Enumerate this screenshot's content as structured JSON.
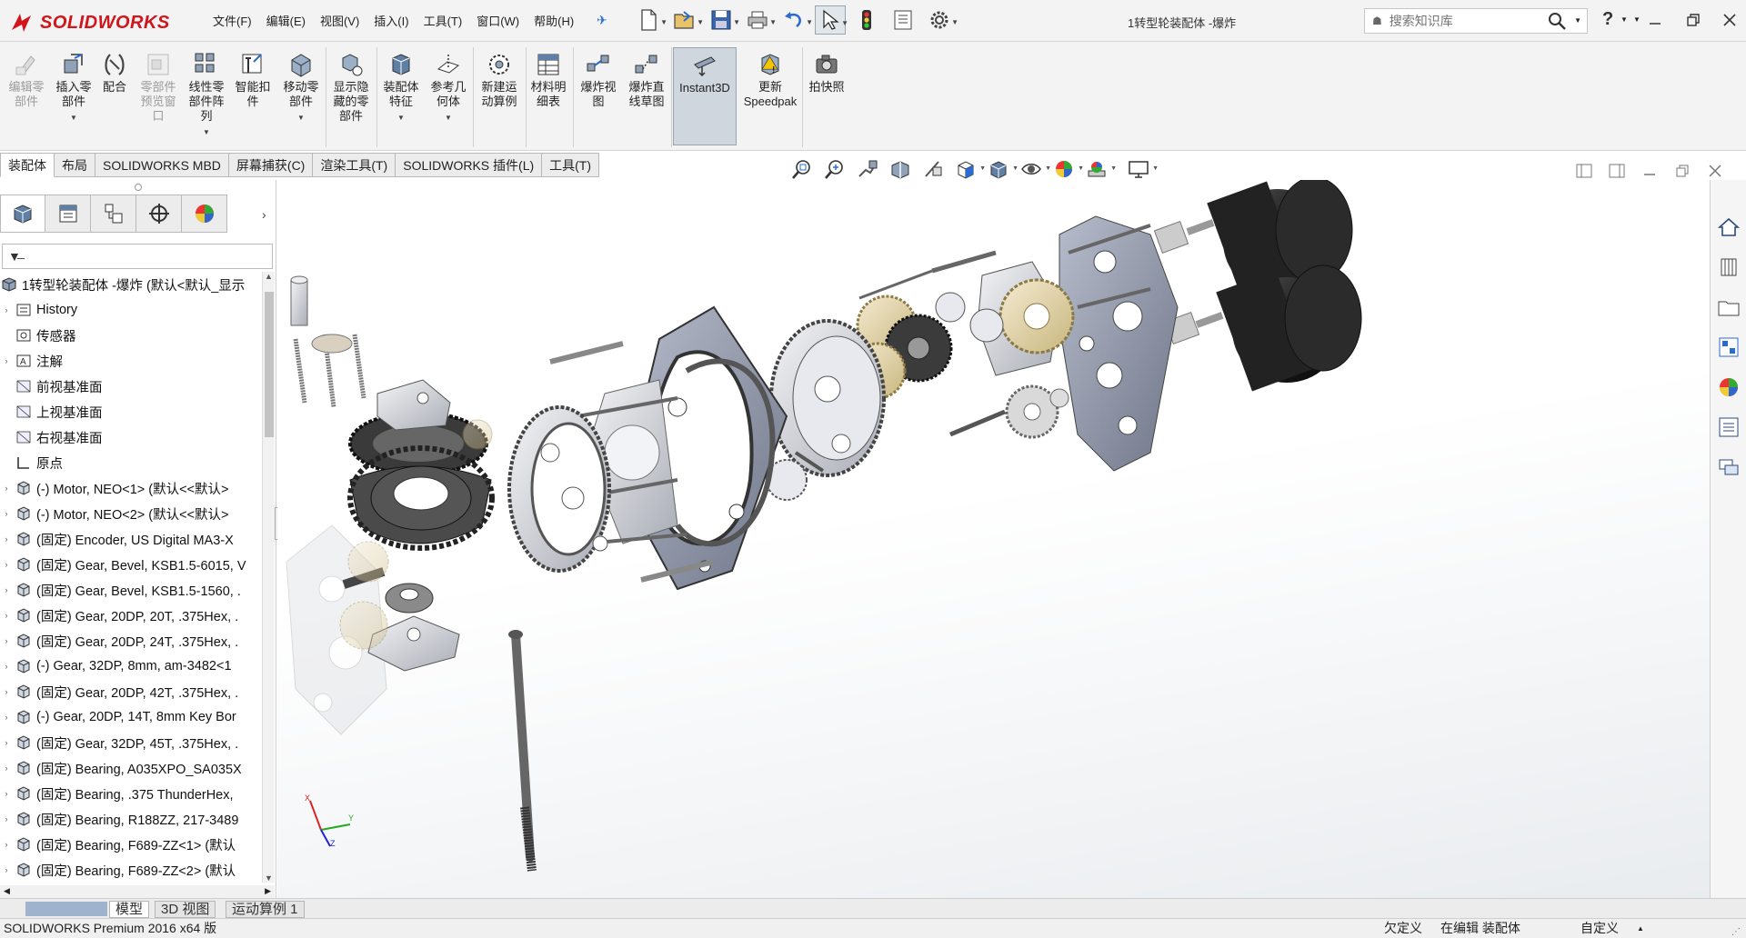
{
  "app": {
    "brand": "SOLIDWORKS",
    "document_title": "1转型轮装配体 -爆炸"
  },
  "menus": [
    "文件(F)",
    "编辑(E)",
    "视图(V)",
    "插入(I)",
    "工具(T)",
    "窗口(W)",
    "帮助(H)"
  ],
  "quick_access": [
    "new-icon",
    "open-icon",
    "save-icon",
    "print-icon",
    "undo-icon",
    "select-icon",
    "rebuild-icon",
    "file-properties-icon",
    "options-icon"
  ],
  "search": {
    "placeholder": "搜索知识库"
  },
  "help_label": "?",
  "commands": [
    {
      "label": "编辑零\n部件",
      "icon": "edit-component-icon",
      "disabled": true
    },
    {
      "label": "插入零\n部件",
      "icon": "insert-component-icon",
      "dropdown": true
    },
    {
      "label": "配合",
      "icon": "mate-icon"
    },
    {
      "label": "零部件\n预览窗\n口",
      "icon": "component-preview-icon",
      "disabled": true
    },
    {
      "label": "线性零\n部件阵\n列",
      "icon": "linear-pattern-icon",
      "dropdown": true
    },
    {
      "label": "智能扣\n件",
      "icon": "smart-fasteners-icon"
    },
    {
      "label": "移动零\n部件",
      "icon": "move-component-icon",
      "dropdown": true
    },
    {
      "label": "显示隐\n藏的零\n部件",
      "icon": "show-hidden-icon"
    },
    {
      "label": "装配体\n特征",
      "icon": "assembly-features-icon",
      "dropdown": true
    },
    {
      "label": "参考几\n何体",
      "icon": "reference-geometry-icon",
      "dropdown": true
    },
    {
      "label": "新建运\n动算例",
      "icon": "new-motion-study-icon"
    },
    {
      "label": "材料明\n细表",
      "icon": "bom-icon"
    },
    {
      "label": "爆炸视\n图",
      "icon": "exploded-view-icon"
    },
    {
      "label": "爆炸直\n线草图",
      "icon": "explode-line-sketch-icon"
    },
    {
      "label": "Instant3D",
      "icon": "instant3d-icon",
      "active": true
    },
    {
      "label": "更新\nSpeedpak",
      "icon": "speedpak-icon"
    },
    {
      "label": "拍快照",
      "icon": "snapshot-icon"
    }
  ],
  "command_tabs": [
    "装配体",
    "布局",
    "SOLIDWORKS MBD",
    "屏幕捕获(C)",
    "渲染工具(T)",
    "SOLIDWORKS 插件(L)",
    "工具(T)"
  ],
  "heads_up": [
    "zoom-to-fit-icon",
    "zoom-to-area-icon",
    "previous-view-icon",
    "section-view-icon",
    "dynamic-annotation-icon",
    "view-orientation-icon",
    "display-style-icon",
    "hide-show-icon",
    "edit-appearance-icon",
    "apply-scene-icon",
    "view-settings-icon"
  ],
  "panel_tabs": [
    "featuremanager-icon",
    "propertymanager-icon",
    "configurationmanager-icon",
    "dimxpert-icon",
    "display-manager-icon"
  ],
  "tree": {
    "root": "1转型轮装配体 -爆炸 (默认<默认_显示",
    "items": [
      {
        "label": "History",
        "icon": "history-icon",
        "expandable": true
      },
      {
        "label": "传感器",
        "icon": "sensor-icon",
        "expandable": false
      },
      {
        "label": "注解",
        "icon": "annotation-icon",
        "expandable": true
      },
      {
        "label": "前视基准面",
        "icon": "plane-icon",
        "expandable": false
      },
      {
        "label": "上视基准面",
        "icon": "plane-icon",
        "expandable": false
      },
      {
        "label": "右视基准面",
        "icon": "plane-icon",
        "expandable": false
      },
      {
        "label": "原点",
        "icon": "origin-icon",
        "expandable": false
      },
      {
        "label": "(-) Motor, NEO<1> (默认<<默认>",
        "icon": "part-icon",
        "expandable": true
      },
      {
        "label": "(-) Motor, NEO<2> (默认<<默认>",
        "icon": "part-icon",
        "expandable": true
      },
      {
        "label": "(固定) Encoder, US Digital MA3-X",
        "icon": "part-icon",
        "expandable": true
      },
      {
        "label": "(固定) Gear, Bevel, KSB1.5-6015, V",
        "icon": "part-icon",
        "expandable": true
      },
      {
        "label": "(固定) Gear, Bevel, KSB1.5-1560, .",
        "icon": "part-icon",
        "expandable": true
      },
      {
        "label": "(固定) Gear, 20DP, 20T, .375Hex, .",
        "icon": "part-icon",
        "expandable": true
      },
      {
        "label": "(固定) Gear, 20DP, 24T, .375Hex, .",
        "icon": "part-icon",
        "expandable": true
      },
      {
        "label": "(-) Gear, 32DP, 8mm, am-3482<1",
        "icon": "part-icon",
        "expandable": true
      },
      {
        "label": "(固定) Gear, 20DP, 42T, .375Hex, .",
        "icon": "part-icon",
        "expandable": true
      },
      {
        "label": "(-) Gear, 20DP, 14T, 8mm Key Bor",
        "icon": "part-icon",
        "expandable": true
      },
      {
        "label": "(固定) Gear, 32DP, 45T, .375Hex, .",
        "icon": "part-icon",
        "expandable": true
      },
      {
        "label": "(固定) Bearing, A035XPO_SA035X",
        "icon": "part-icon",
        "expandable": true
      },
      {
        "label": "(固定) Bearing, .375 ThunderHex,",
        "icon": "part-icon",
        "expandable": true
      },
      {
        "label": "(固定) Bearing, R188ZZ, 217-3489",
        "icon": "part-icon",
        "expandable": true
      },
      {
        "label": "(固定) Bearing, F689-ZZ<1> (默认",
        "icon": "part-icon",
        "expandable": true
      },
      {
        "label": "(固定) Bearing, F689-ZZ<2> (默认",
        "icon": "part-icon",
        "expandable": true
      }
    ]
  },
  "task_pane": [
    "solidworks-resources-icon",
    "design-library-icon",
    "file-explorer-icon",
    "view-palette-icon",
    "appearances-icon",
    "custom-properties-icon",
    "forum-icon"
  ],
  "bottom_tabs": [
    {
      "label": "模型",
      "active": true
    },
    {
      "label": "3D 视图",
      "active": false
    },
    {
      "label": "运动算例 1",
      "active": false
    }
  ],
  "status": {
    "product": "SOLIDWORKS Premium 2016 x64 版",
    "defined": "欠定义",
    "editing": "在编辑 装配体",
    "units": "自定义"
  },
  "colors": {
    "brand_red": "#d2141b",
    "accent_blue": "#2a6bd1",
    "active_cmd": "#cfd6dd"
  }
}
